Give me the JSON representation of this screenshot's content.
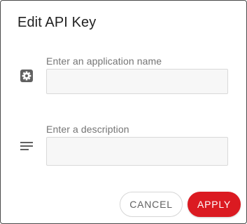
{
  "dialog": {
    "title": "Edit API Key"
  },
  "fields": {
    "application_name": {
      "label": "Enter an application name",
      "value": "",
      "icon": "gear-icon"
    },
    "description": {
      "label": "Enter a description",
      "value": "",
      "icon": "notes-lines-icon"
    }
  },
  "actions": {
    "cancel_label": "CANCEL",
    "apply_label": "APPLY"
  },
  "colors": {
    "accent": "#db1a21",
    "icon": "#616161"
  }
}
